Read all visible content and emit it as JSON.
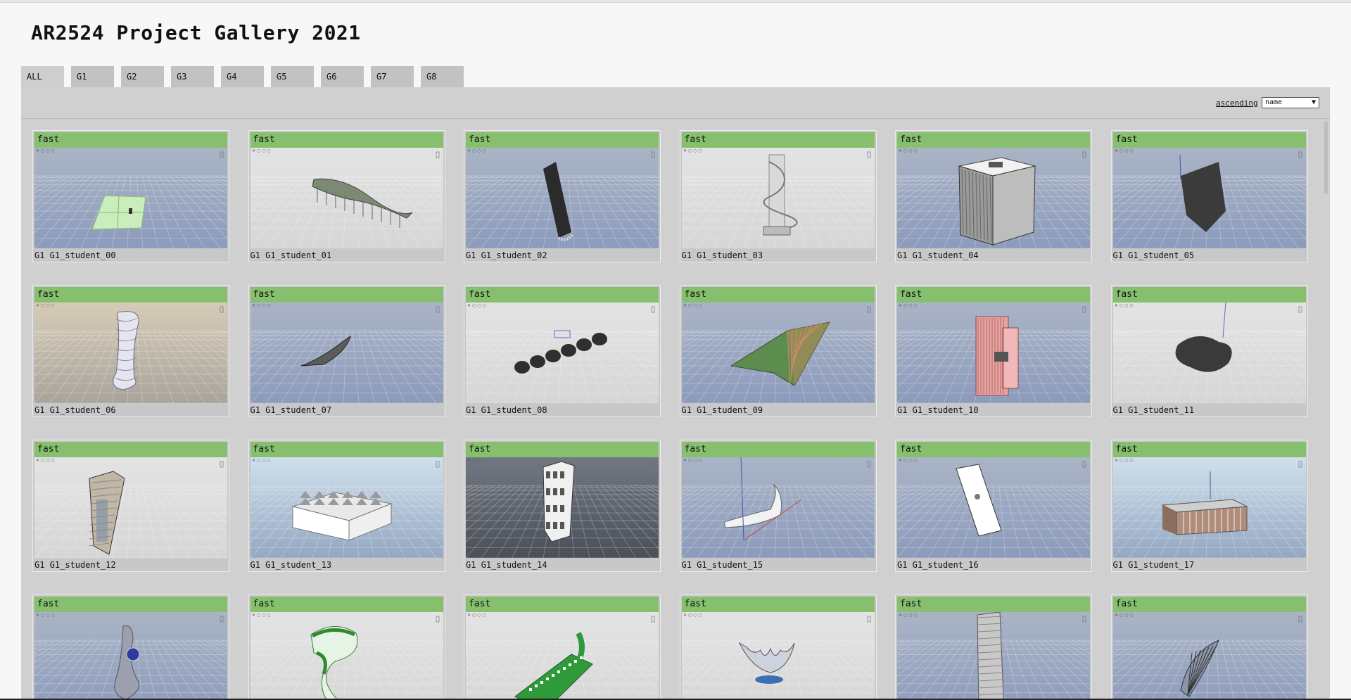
{
  "page": {
    "title": "AR2524 Project Gallery 2021"
  },
  "tabs": [
    "ALL",
    "G1",
    "G2",
    "G3",
    "G4",
    "G5",
    "G6",
    "G7",
    "G8"
  ],
  "sort": {
    "order_label": "ascending",
    "selected": "name"
  },
  "gallery": {
    "badge": "fast",
    "items": [
      {
        "label": "G1 G1_student_00",
        "bg": "blue",
        "model": "plate"
      },
      {
        "label": "G1 G1_student_01",
        "bg": "gray",
        "model": "wave"
      },
      {
        "label": "G1 G1_student_02",
        "bg": "blue",
        "model": "slab"
      },
      {
        "label": "G1 G1_student_03",
        "bg": "gray",
        "model": "twist"
      },
      {
        "label": "G1 G1_student_04",
        "bg": "blue",
        "model": "cube"
      },
      {
        "label": "G1 G1_student_05",
        "bg": "blue",
        "model": "arrow"
      },
      {
        "label": "G1 G1_student_06",
        "bg": "cloud",
        "model": "tower"
      },
      {
        "label": "G1 G1_student_07",
        "bg": "blue",
        "model": "boat"
      },
      {
        "label": "G1 G1_student_08",
        "bg": "gray",
        "model": "chain"
      },
      {
        "label": "G1 G1_student_09",
        "bg": "blue",
        "model": "greenplate"
      },
      {
        "label": "G1 G1_student_10",
        "bg": "blue",
        "model": "pinkblock"
      },
      {
        "label": "G1 G1_student_11",
        "bg": "gray",
        "model": "blob"
      },
      {
        "label": "G1 G1_student_12",
        "bg": "gray",
        "model": "tallglass"
      },
      {
        "label": "G1 G1_student_13",
        "bg": "sky",
        "model": "roof"
      },
      {
        "label": "G1 G1_student_14",
        "bg": "dark",
        "model": "pillar"
      },
      {
        "label": "G1 G1_student_15",
        "bg": "blue",
        "model": "tail"
      },
      {
        "label": "G1 G1_student_16",
        "bg": "blue",
        "model": "card"
      },
      {
        "label": "G1 G1_student_17",
        "bg": "sky",
        "model": "shed"
      },
      {
        "label": "",
        "bg": "blue",
        "model": "curl"
      },
      {
        "label": "",
        "bg": "gray",
        "model": "greenspiral"
      },
      {
        "label": "",
        "bg": "gray",
        "model": "greenframe"
      },
      {
        "label": "",
        "bg": "gray",
        "model": "shell"
      },
      {
        "label": "",
        "bg": "blue",
        "model": "skyscraper"
      },
      {
        "label": "",
        "bg": "blue",
        "model": "fan"
      }
    ]
  }
}
